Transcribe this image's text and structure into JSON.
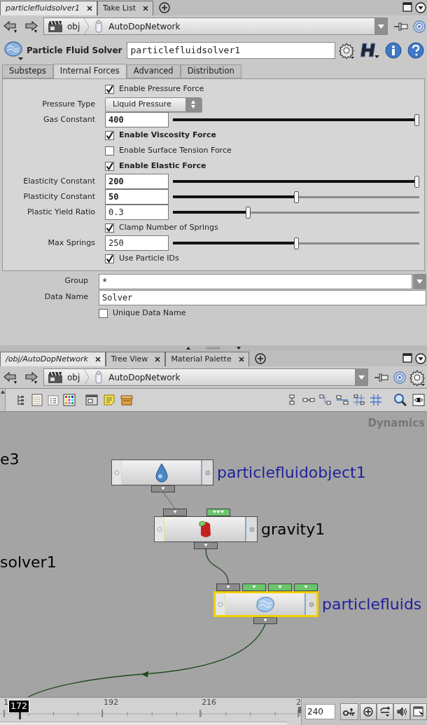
{
  "top_pane": {
    "tabs": [
      {
        "label": "particlefluidsolver1",
        "selected": true
      },
      {
        "label": "Take List",
        "selected": false
      }
    ],
    "path": [
      "obj",
      "AutoDopNetwork"
    ],
    "node_type": "Particle Fluid Solver",
    "node_name": "particlefluidsolver1",
    "parameter_tabs": [
      {
        "label": "Substeps",
        "selected": false
      },
      {
        "label": "Internal Forces",
        "selected": true
      },
      {
        "label": "Advanced",
        "selected": false
      },
      {
        "label": "Distribution",
        "selected": false
      }
    ],
    "parameters": [
      {
        "kind": "checkbox",
        "label": "Enable Pressure Force",
        "checked": true,
        "bold": false
      },
      {
        "kind": "menu",
        "label": "Pressure Type",
        "value": "Liquid Pressure"
      },
      {
        "kind": "slider",
        "label": "Gas Constant",
        "value": "400",
        "bold": true,
        "level": 1
      },
      {
        "kind": "checkbox",
        "label": "Enable Viscosity Force",
        "checked": true,
        "bold": true
      },
      {
        "kind": "checkbox",
        "label": "Enable Surface Tension Force",
        "checked": false,
        "bold": false
      },
      {
        "kind": "checkbox",
        "label": "Enable Elastic Force",
        "checked": true,
        "bold": true
      },
      {
        "kind": "slider",
        "label": "Elasticity Constant",
        "value": "200",
        "bold": true,
        "level": 1
      },
      {
        "kind": "slider",
        "label": "Plasticity Constant",
        "value": "50",
        "bold": true,
        "level": 0.5
      },
      {
        "kind": "slider",
        "label": "Plastic Yield Ratio",
        "value": "0.3",
        "bold": false,
        "level": 0.3
      },
      {
        "kind": "checkbox",
        "label": "Clamp Number of Springs",
        "checked": true,
        "bold": false
      },
      {
        "kind": "slider",
        "label": "Max Springs",
        "value": "250",
        "bold": false,
        "level": 0.5
      },
      {
        "kind": "checkbox",
        "label": "Use Particle IDs",
        "checked": true,
        "bold": false
      }
    ],
    "common_parameters": [
      {
        "kind": "combo",
        "label": "Group",
        "value": "*"
      },
      {
        "kind": "text",
        "label": "Data Name",
        "value": "Solver"
      },
      {
        "kind": "checkbox",
        "label": "Unique Data Name",
        "checked": false
      }
    ]
  },
  "bottom_pane": {
    "tabs": [
      {
        "label": "/obj/AutoDopNetwork",
        "selected": true
      },
      {
        "label": "Tree View",
        "selected": false
      },
      {
        "label": "Material Palette",
        "selected": false
      }
    ],
    "path": [
      "obj",
      "AutoDopNetwork"
    ],
    "network": {
      "context": "Dynamics",
      "partial_labels": [
        "e3",
        "solver1"
      ],
      "nodes": [
        {
          "name": "particlefluidobject1",
          "kind": "object",
          "selected": false,
          "color": "#1f1f9c"
        },
        {
          "name": "gravity1",
          "kind": "force",
          "selected": false,
          "color": "#000000",
          "inputs": [
            {
              "kind": "object"
            },
            {
              "kind": "multi"
            }
          ]
        },
        {
          "name": "particlefluids",
          "kind": "solver",
          "selected": true,
          "color": "#1f1f9c",
          "inputs": [
            {
              "kind": "object"
            },
            {
              "kind": "data"
            },
            {
              "kind": "data"
            },
            {
              "kind": "data"
            }
          ]
        }
      ]
    }
  },
  "timeline": {
    "ticks": [
      "1",
      "192",
      "216",
      "2"
    ],
    "current_frame": "172",
    "end_frame": "240"
  }
}
